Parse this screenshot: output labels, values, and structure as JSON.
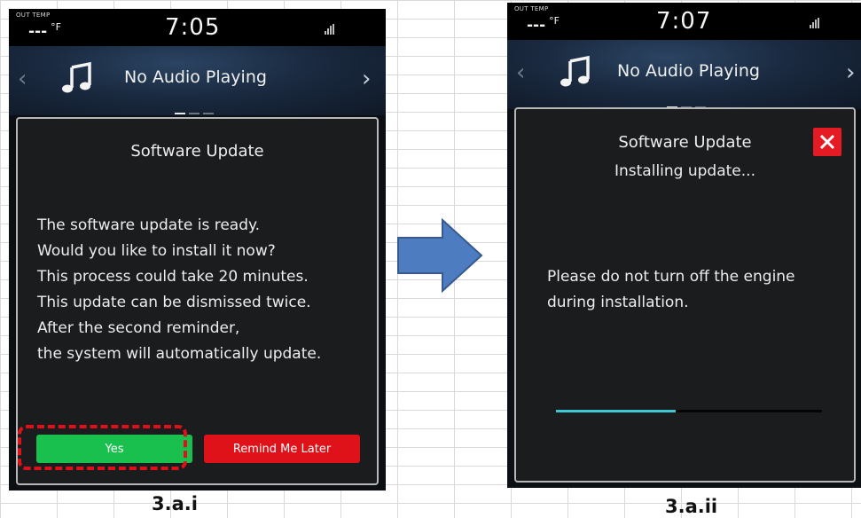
{
  "left_screen": {
    "status": {
      "out_temp_label": "OUT TEMP",
      "temp_value": "---",
      "temp_unit": "°F",
      "time": "7:05"
    },
    "audio": {
      "text": "No Audio Playing"
    },
    "dialog": {
      "title": "Software Update",
      "body_lines": [
        "The software update is ready.",
        "Would you like to install it now?",
        "This process could take 20 minutes.",
        "This update can be dismissed twice.",
        "After the second reminder,",
        "the system will automatically update."
      ],
      "yes_label": "Yes",
      "remind_label": "Remind Me Later"
    }
  },
  "right_screen": {
    "status": {
      "out_temp_label": "OUT TEMP",
      "temp_value": "---",
      "temp_unit": "°F",
      "time": "7:07"
    },
    "audio": {
      "text": "No Audio Playing"
    },
    "dialog": {
      "title": "Software Update",
      "subtitle": "Installing update...",
      "body_lines": [
        "Please do not turn off the engine",
        "during installation."
      ],
      "progress_fraction": 0.45
    }
  },
  "captions": {
    "left": "3.a.i",
    "right": "3.a.ii"
  },
  "colors": {
    "accent_yes": "#19c04e",
    "accent_remind": "#df1119",
    "highlight": "#e0101a",
    "progress": "#3fc7d4",
    "arrow": "#4e7cc1"
  },
  "icons": {
    "music": "music-note-icon",
    "signal": "signal-lte-icon",
    "close": "close-icon",
    "nav_left": "chevron-left-icon",
    "nav_right": "chevron-right-icon",
    "transition": "arrow-right-icon"
  }
}
